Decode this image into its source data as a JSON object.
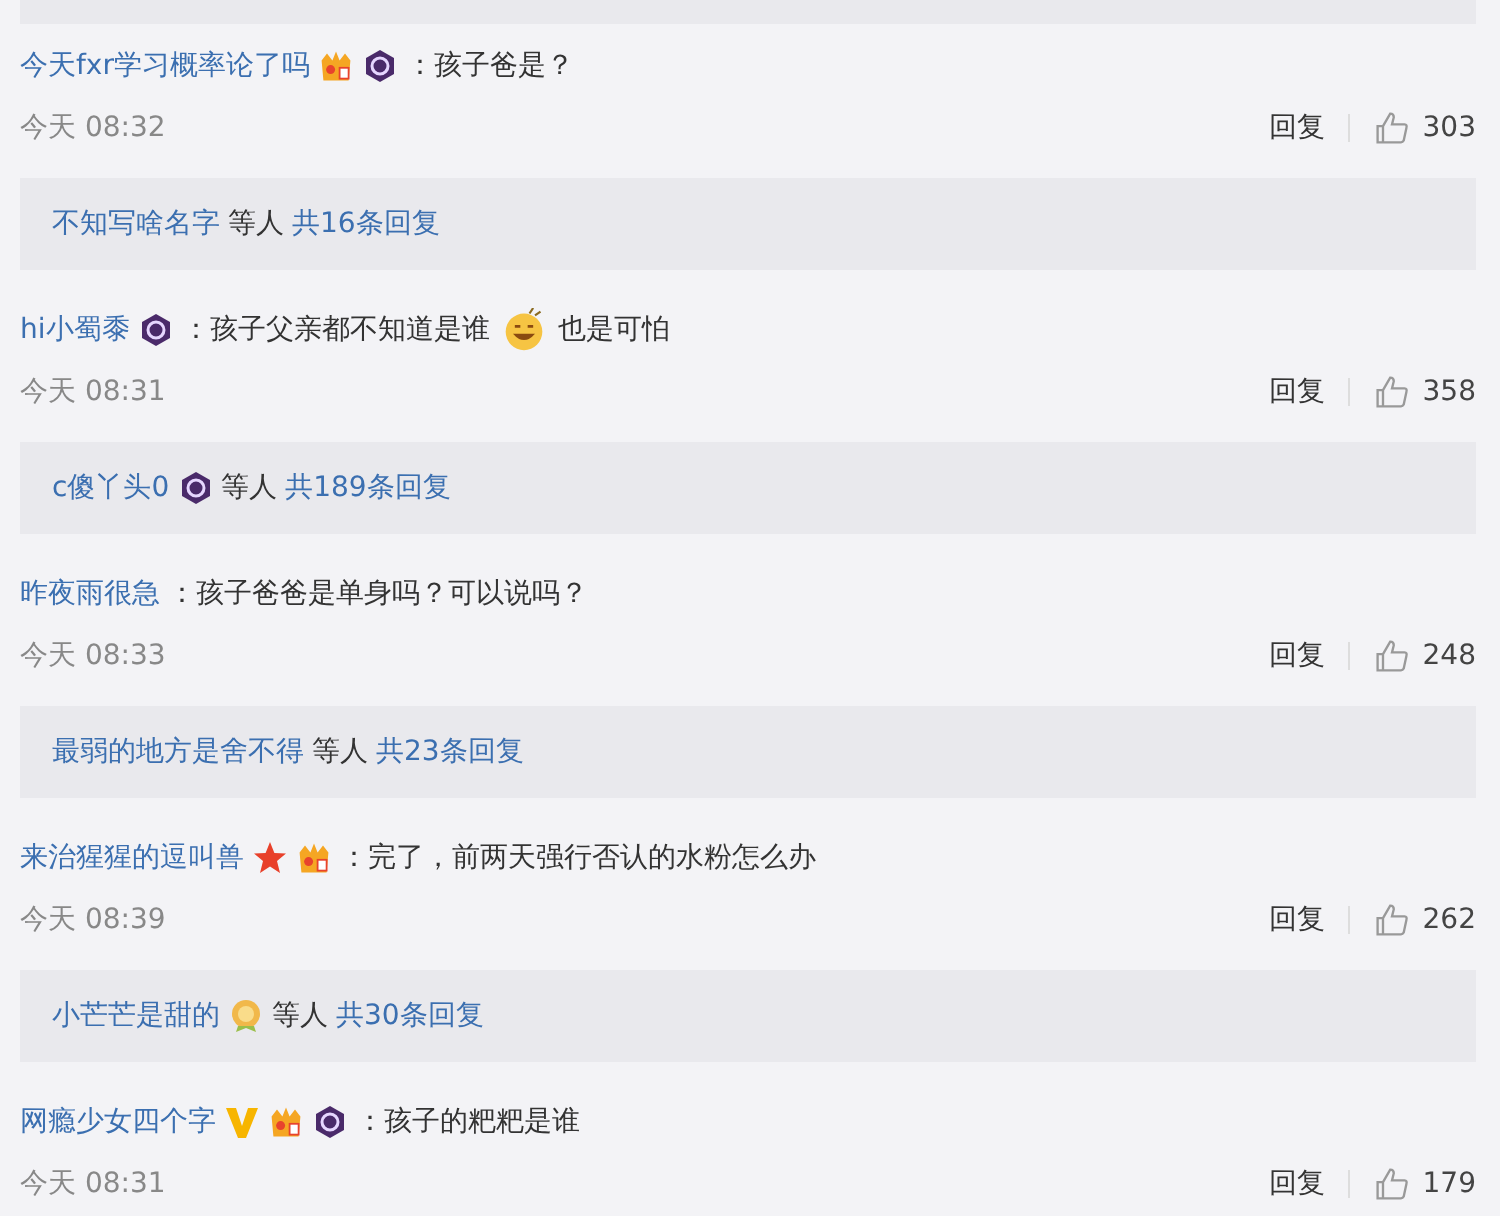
{
  "comments": [
    {
      "user": "今天fxr学习概率论了吗",
      "badges": [
        {
          "kind": "fan"
        },
        {
          "kind": "night"
        }
      ],
      "body": [
        {
          "kind": "text",
          "text": "：孩子爸是？"
        }
      ],
      "time": "今天 08:32",
      "reply": "回复",
      "likes": "303",
      "thread": {
        "users": [
          {
            "name": "不知写啥名字"
          }
        ],
        "suffix": "等人",
        "count": "共16条回复"
      }
    },
    {
      "user": "hi小蜀黍",
      "badges": [
        {
          "kind": "night"
        }
      ],
      "body": [
        {
          "kind": "text",
          "text": "：孩子父亲都不知道是谁"
        },
        {
          "kind": "emoji"
        },
        {
          "kind": "text",
          "text": "也是可怕"
        }
      ],
      "time": "今天 08:31",
      "reply": "回复",
      "likes": "358",
      "thread": {
        "users": [
          {
            "name": "c傻丫头0",
            "badges": [
              {
                "kind": "night"
              }
            ]
          }
        ],
        "suffix": "等人",
        "count": "共189条回复"
      }
    },
    {
      "user": "昨夜雨很急",
      "body": [
        {
          "kind": "text",
          "text": "：孩子爸爸是单身吗？可以说吗？"
        }
      ],
      "time": "今天 08:33",
      "reply": "回复",
      "likes": "248",
      "thread": {
        "users": [
          {
            "name": "最弱的地方是舍不得"
          }
        ],
        "suffix": "等人",
        "count": "共23条回复"
      }
    },
    {
      "user": "来治猩猩的逗叫兽",
      "badges": [
        {
          "kind": "star"
        },
        {
          "kind": "fan"
        }
      ],
      "body": [
        {
          "kind": "text",
          "text": "：完了，前两天强行否认的水粉怎么办"
        }
      ],
      "time": "今天 08:39",
      "reply": "回复",
      "likes": "262",
      "thread": {
        "users": [
          {
            "name": "小芒芒是甜的",
            "badges": [
              {
                "kind": "medal"
              }
            ]
          }
        ],
        "suffix": "等人",
        "count": "共30条回复"
      }
    },
    {
      "user": "网瘾少女四个字",
      "badges": [
        {
          "kind": "vip"
        },
        {
          "kind": "fan"
        },
        {
          "kind": "night"
        }
      ],
      "body": [
        {
          "kind": "text",
          "text": "：孩子的粑粑是谁"
        }
      ],
      "time": "今天 08:31",
      "reply": "回复",
      "likes": "179"
    }
  ]
}
